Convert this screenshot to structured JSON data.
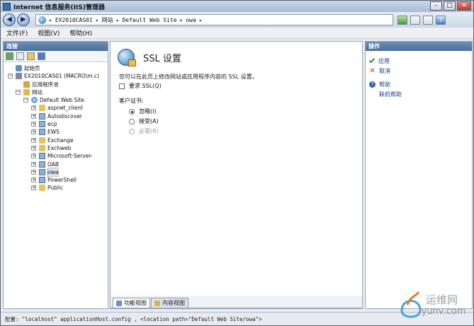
{
  "window": {
    "title": "Internet 信息服务(IIS)管理器",
    "controls": {
      "minimize": "–",
      "maximize": "□",
      "close": "✕"
    }
  },
  "address_bar": {
    "breadcrumbs": [
      "EX2010CAS01",
      "网站",
      "Default Web Site",
      "owa"
    ],
    "separator": "▸"
  },
  "menu": {
    "items": [
      "文件(F)",
      "视图(V)",
      "帮助(H)"
    ]
  },
  "connections": {
    "header": "连接",
    "tree": [
      {
        "label": "起始页",
        "icon": "home-icon",
        "level": 0,
        "expander": ""
      },
      {
        "label": "EX2010CAS01 (MACRO\\m.c)",
        "icon": "server-icon",
        "level": 0,
        "expander": "−"
      },
      {
        "label": "应用程序池",
        "icon": "app-pool-icon",
        "level": 1,
        "expander": ""
      },
      {
        "label": "网站",
        "icon": "sites-folder-icon",
        "level": 1,
        "expander": "−"
      },
      {
        "label": "Default Web Site",
        "icon": "globe-site-icon",
        "level": 2,
        "expander": "−"
      },
      {
        "label": "aspnet_client",
        "icon": "folder-icon",
        "level": 3,
        "expander": "+"
      },
      {
        "label": "Autodiscover",
        "icon": "application-icon",
        "level": 3,
        "expander": "+"
      },
      {
        "label": "ecp",
        "icon": "application-icon",
        "level": 3,
        "expander": "+"
      },
      {
        "label": "EWS",
        "icon": "application-icon",
        "level": 3,
        "expander": "+"
      },
      {
        "label": "Exchange",
        "icon": "folder-icon",
        "level": 3,
        "expander": "+"
      },
      {
        "label": "Exchweb",
        "icon": "folder-icon",
        "level": 3,
        "expander": "+"
      },
      {
        "label": "Microsoft-Server-",
        "icon": "application-icon",
        "level": 3,
        "expander": "+"
      },
      {
        "label": "OAB",
        "icon": "application-icon",
        "level": 3,
        "expander": "+"
      },
      {
        "label": "owa",
        "icon": "application-icon",
        "level": 3,
        "expander": "+",
        "selected": true
      },
      {
        "label": "PowerShell",
        "icon": "application-icon",
        "level": 3,
        "expander": "+"
      },
      {
        "label": "Public",
        "icon": "folder-icon",
        "level": 3,
        "expander": "+"
      }
    ]
  },
  "ssl_settings": {
    "title": "SSL 设置",
    "description": "您可以在此页上修改网站或应用程序内容的 SSL 设置。",
    "require_ssl_label": "要求 SSL(Q)",
    "require_ssl_checked": false,
    "client_cert_label": "客户证书:",
    "options": [
      {
        "label": "忽略(I)",
        "checked": true,
        "disabled": false
      },
      {
        "label": "接受(A)",
        "checked": false,
        "disabled": false
      },
      {
        "label": "必需(R)",
        "checked": false,
        "disabled": true
      }
    ]
  },
  "view_tabs": [
    "功能视图",
    "内容视图"
  ],
  "actions": {
    "header": "操作",
    "items": [
      {
        "label": "应用",
        "icon": "apply-icon"
      },
      {
        "label": "取消",
        "icon": "cancel-icon"
      },
      {
        "label": "帮助",
        "icon": "help-icon"
      },
      {
        "label": "联机帮助",
        "icon": ""
      }
    ]
  },
  "status_bar": "配置: \"localhost\" applicationHost.config , <location path=\"Default Web Site/owa\">",
  "watermark": {
    "line1": "运维网",
    "line2": "iyunv.com"
  }
}
